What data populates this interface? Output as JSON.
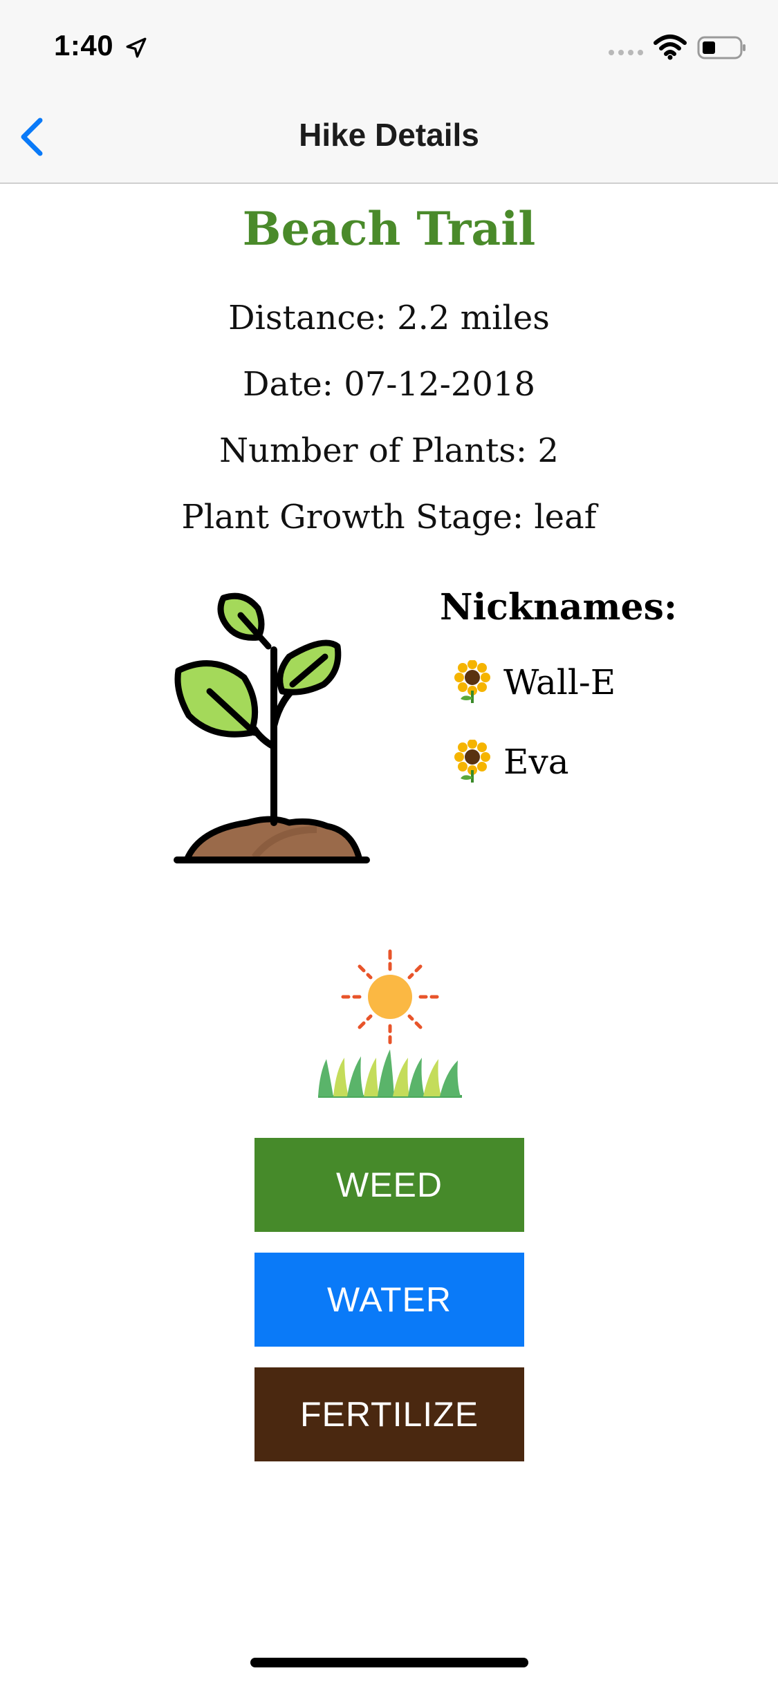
{
  "status_bar": {
    "time": "1:40",
    "icons": [
      "location-arrow-icon",
      "signal-icon",
      "wifi-icon",
      "battery-icon"
    ]
  },
  "nav": {
    "back_icon": "chevron-left-icon",
    "title": "Hike Details",
    "accent": "#0a7af8"
  },
  "hike": {
    "name": "Beach Trail",
    "distance": "Distance: 2.2 miles",
    "date": "Date: 07-12-2018",
    "plants": "Number of Plants: 2",
    "stage": "Plant Growth Stage: leaf",
    "title_color": "#4a8a2a"
  },
  "illustrations": [
    "sprout-icon",
    "sun-grass-icon"
  ],
  "nicknames": {
    "title": "Nicknames:",
    "icon": "sunflower-icon",
    "items": [
      "Wall-E",
      "Eva"
    ]
  },
  "actions": {
    "weed": "WEED",
    "water": "WATER",
    "fertilize": "FERTILIZE",
    "colors": {
      "weed": "#468a2a",
      "water": "#0a7af8",
      "fertilize": "#4a2810"
    }
  }
}
